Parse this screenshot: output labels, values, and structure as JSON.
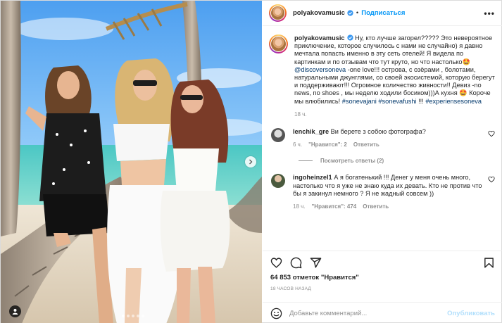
{
  "post": {
    "username": "polyakovamusic",
    "follow_label": "Подписаться",
    "separator": "•",
    "more_label": "•••",
    "caption": {
      "username": "polyakovamusic",
      "part1": " Ну, кто лучше загорел????? Это невероятное приключение, которое случилось с нами не случайно) я давно мечтала попасть именно в эту сеть отелей! Я видела по картинкам и по отзывам что тут круто, но что настолько🤩 ",
      "mention": "@discoversoneva",
      "part2": " -one love!!! острова, с озёрами , болотами, натуральными джунглями, со своей экосистемой, которую берегут и поддерживают!!! Огромное количество живности!! Девиз -no news, no shoes , мы неделю ходили босиком)))А кухня 🤩 Короче мы влюбились! ",
      "tag1": "#sonevajani",
      "tag2": "#sonevafushi",
      "part3": " !!! ",
      "tag3": "#experiensesoneva",
      "time": "18 ч."
    },
    "comments": [
      {
        "username": "lenchik_gre",
        "text": " Ви берете з собою фотографа?",
        "time": "6 ч.",
        "likes": "\"Нравится\": 2",
        "reply": "Ответить"
      },
      {
        "username": "ingoheinzel1",
        "text": " А я богатенький !!! Денег у меня очень много, настолько что я уже не знаю куда их девать. Кто не против что бы я закинул немного ? Я не жадный совсем ))",
        "time": "18 ч.",
        "likes": "\"Нравится\": 474",
        "reply": "Ответить"
      }
    ],
    "view_replies": "Посмотреть ответы (2)",
    "likes_line": "64 853 отметок \"Нравится\"",
    "posted_time": "18 ЧАСОВ НАЗАД",
    "add_comment_placeholder": "Добавьте комментарий...",
    "publish_label": "Опубликовать"
  },
  "colors": {
    "link": "#00376b",
    "follow": "#0095f6",
    "publish_disabled": "#b2dffc",
    "meta": "#8e8e8e"
  },
  "icons": [
    "verified-badge-icon",
    "more-options-icon",
    "heart-icon",
    "comment-icon",
    "share-icon",
    "bookmark-icon",
    "emoji-icon",
    "chevron-right-icon",
    "user-tag-icon"
  ]
}
